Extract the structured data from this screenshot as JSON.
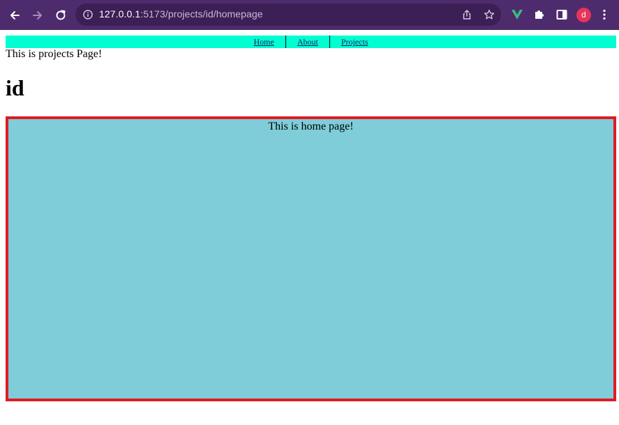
{
  "browser": {
    "url_host": "127.0.0.1",
    "url_rest": ":5173/projects/id/homepage",
    "avatar_letter": "d",
    "icons": [
      "back-arrow-icon",
      "forward-arrow-icon",
      "reload-icon",
      "info-icon",
      "share-icon",
      "star-icon",
      "vue-extension-icon",
      "puzzle-extension-icon",
      "side-panel-icon",
      "kebab-menu-icon"
    ],
    "colors": {
      "frame": "#4e2b6d",
      "omnibox": "#3b1f55",
      "avatar": "#e8335a",
      "vue": "#41b883"
    }
  },
  "nav": {
    "links": [
      {
        "label": "Home"
      },
      {
        "label": "About"
      },
      {
        "label": "Projects"
      }
    ],
    "background": "#00ffd0"
  },
  "content": {
    "projects_text": "This is projects Page!",
    "heading": "id",
    "home_text": "This is home page!",
    "home_box_background": "#7ecdd9",
    "home_box_border": "#e01a24"
  }
}
